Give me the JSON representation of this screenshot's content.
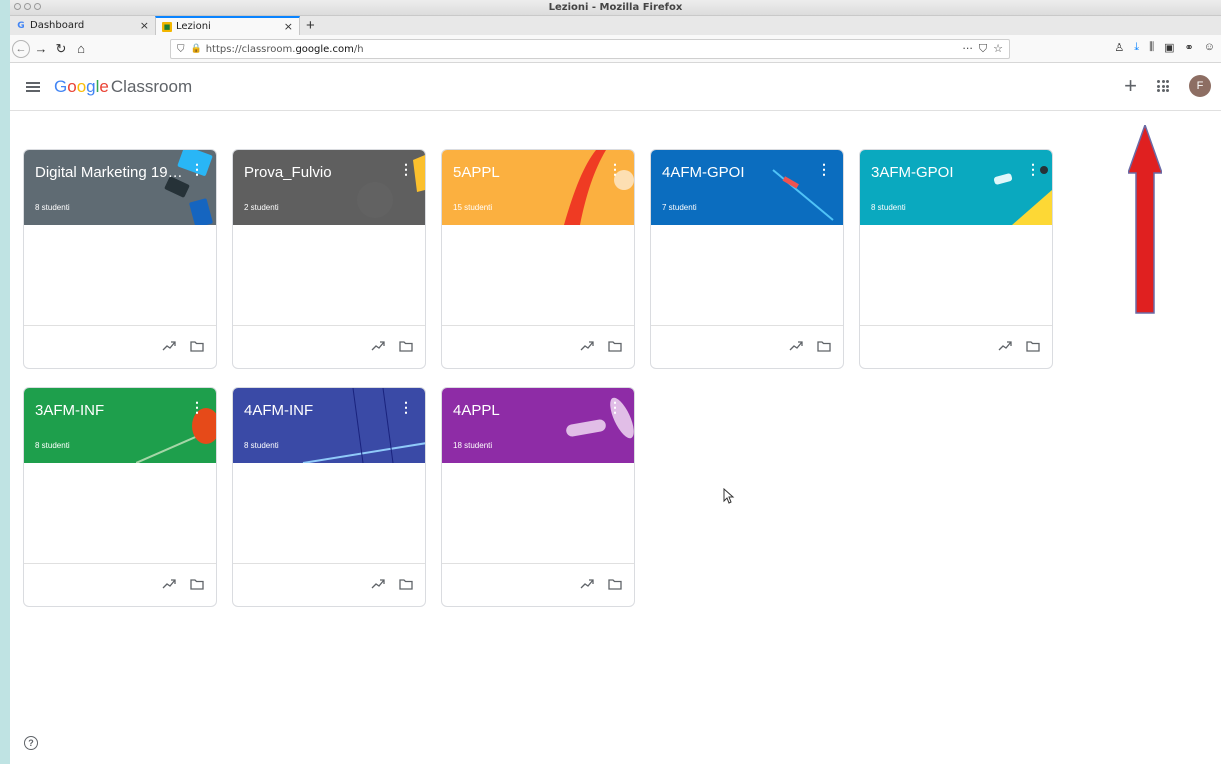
{
  "window": {
    "title": "Lezioni - Mozilla Firefox"
  },
  "tabs": [
    {
      "label": "Dashboard",
      "favicon": "G"
    },
    {
      "label": "Lezioni",
      "favicon": "classroom-icon"
    }
  ],
  "urlbar": {
    "prefix": "https://classroom.",
    "host": "google.com",
    "path": "/h"
  },
  "app": {
    "logo_google": [
      "G",
      "o",
      "o",
      "g",
      "l",
      "e"
    ],
    "logo_product": "Classroom",
    "avatar_initial": "F"
  },
  "classes": [
    {
      "title": "Digital Marketing 19-...",
      "students": "8 studenti",
      "color": "#5f6b73"
    },
    {
      "title": "Prova_Fulvio",
      "students": "2 studenti",
      "color": "#5f5f5f"
    },
    {
      "title": "5APPL",
      "students": "15 studenti",
      "color": "#fbb040"
    },
    {
      "title": "4AFM-GPOI",
      "students": "7 studenti",
      "color": "#0b6dbf"
    },
    {
      "title": "3AFM-GPOI",
      "students": "8 studenti",
      "color": "#0aa9bf"
    },
    {
      "title": "3AFM-INF",
      "students": "8 studenti",
      "color": "#1e9f4c"
    },
    {
      "title": "4AFM-INF",
      "students": "8 studenti",
      "color": "#3a4aa6"
    },
    {
      "title": "4APPL",
      "students": "18 studenti",
      "color": "#8e2ca6"
    }
  ],
  "help_icon": "?"
}
